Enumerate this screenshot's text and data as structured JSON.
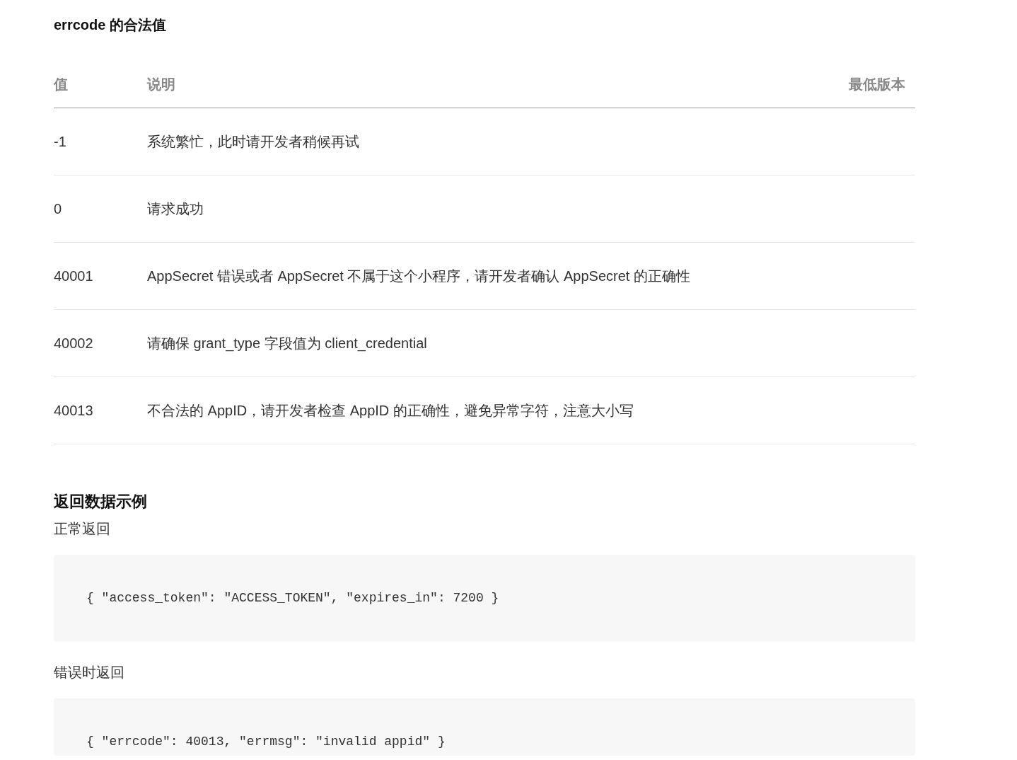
{
  "errcode_section": {
    "title": "errcode 的合法值",
    "table": {
      "columns": [
        "值",
        "说明",
        "最低版本"
      ],
      "rows": [
        {
          "value": "-1",
          "description": "系统繁忙，此时请开发者稍候再试"
        },
        {
          "value": "0",
          "description": "请求成功"
        },
        {
          "value": "40001",
          "description": "AppSecret 错误或者 AppSecret 不属于这个小程序，请开发者确认 AppSecret 的正确性"
        },
        {
          "value": "40002",
          "description": "请确保 grant_type 字段值为 client_credential"
        },
        {
          "value": "40013",
          "description": "不合法的 AppID，请开发者检查 AppID 的正确性，避免异常字符，注意大小写"
        }
      ]
    }
  },
  "example_section": {
    "title": "返回数据示例",
    "examples": [
      {
        "label": "正常返回",
        "code": "{ \"access_token\": \"ACCESS_TOKEN\", \"expires_in\": 7200 }"
      },
      {
        "label": "错误时返回",
        "code": "{ \"errcode\": 40013, \"errmsg\": \"invalid appid\" }"
      }
    ]
  }
}
